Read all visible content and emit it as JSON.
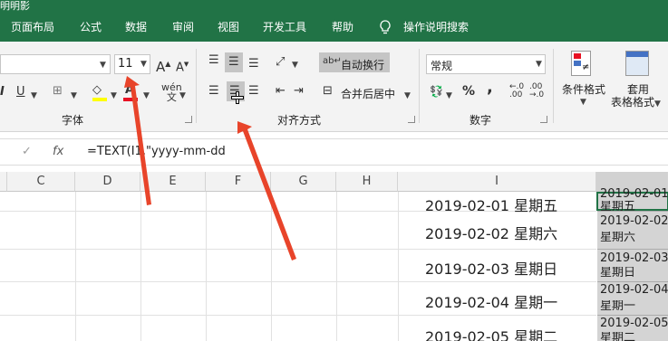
{
  "titlebar": {
    "title": "明明影"
  },
  "menu": {
    "items": [
      "页面布局",
      "公式",
      "数据",
      "审阅",
      "视图",
      "开发工具",
      "帮助"
    ],
    "tell_me": "操作说明搜索"
  },
  "ribbon": {
    "font": {
      "size": "11",
      "group_label": "字体"
    },
    "alignment": {
      "wrap_text": "自动换行",
      "merge_center": "合并后居中",
      "group_label": "对齐方式"
    },
    "number": {
      "format": "常规",
      "percent": "%",
      "comma": ",",
      "group_label": "数字"
    },
    "styles": {
      "conditional": "条件格式",
      "table_1": "套用",
      "table_2": "表格格式"
    }
  },
  "formula_bar": {
    "cancel": "✓",
    "fx": "fx",
    "formula": "=TEXT(I1,\"yyyy-mm-dd"
  },
  "sheet": {
    "columns": [
      "C",
      "D",
      "E",
      "F",
      "G",
      "H",
      "I"
    ],
    "col_i_values": [
      "2019-02-01 星期五",
      "2019-02-02 星期六",
      "2019-02-03 星期日",
      "2019-02-04 星期一",
      "2019-02-05 星期二"
    ],
    "col_j_values": [
      {
        "date": "2019-02-01",
        "day": "星期五"
      },
      {
        "date": "2019-02-02",
        "day": "星期六"
      },
      {
        "date": "2019-02-03",
        "day": "星期日"
      },
      {
        "date": "2019-02-04",
        "day": "星期一"
      },
      {
        "date": "2019-02-05",
        "day": "星期二"
      }
    ]
  },
  "colors": {
    "accent": "#217346",
    "arrow": "#e8442a"
  }
}
